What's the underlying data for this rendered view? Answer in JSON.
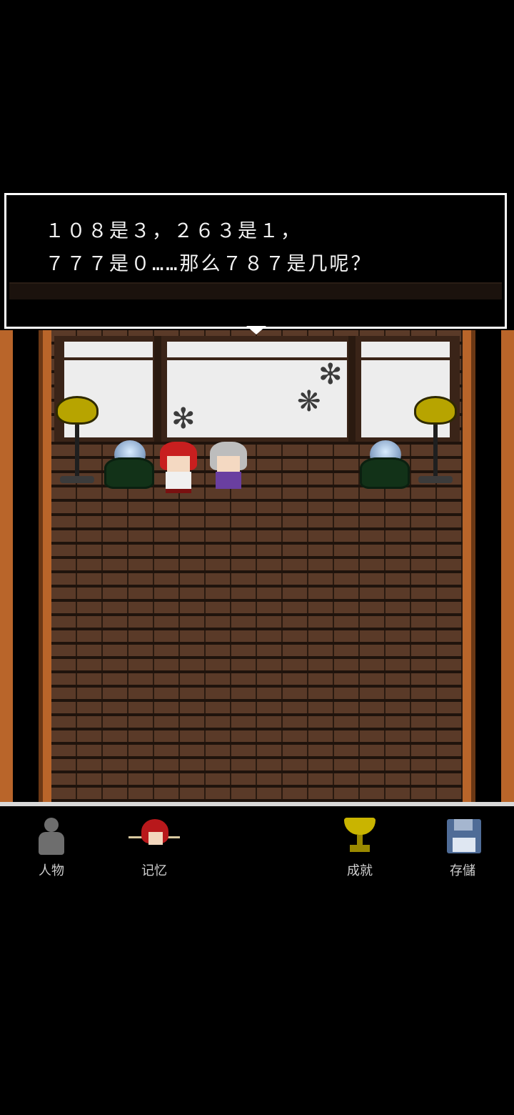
{
  "dialog": {
    "line1": "１０８是３，２６３是１，",
    "line2": "７７７是０……那么７８７是几呢？"
  },
  "menu": {
    "characters_label": "人物",
    "memory_label": "记忆",
    "achievements_label": "成就",
    "save_label": "存儲"
  },
  "icons": {
    "characters": "person-silhouette-icon",
    "memory": "red-haired-girl-icon",
    "achievements": "trophy-icon",
    "save": "floppy-disk-icon"
  },
  "colors": {
    "pillar": "#b9652a",
    "trophy": "#c9b400",
    "save": "#4f6c97",
    "red_hair": "#c81f1f"
  }
}
